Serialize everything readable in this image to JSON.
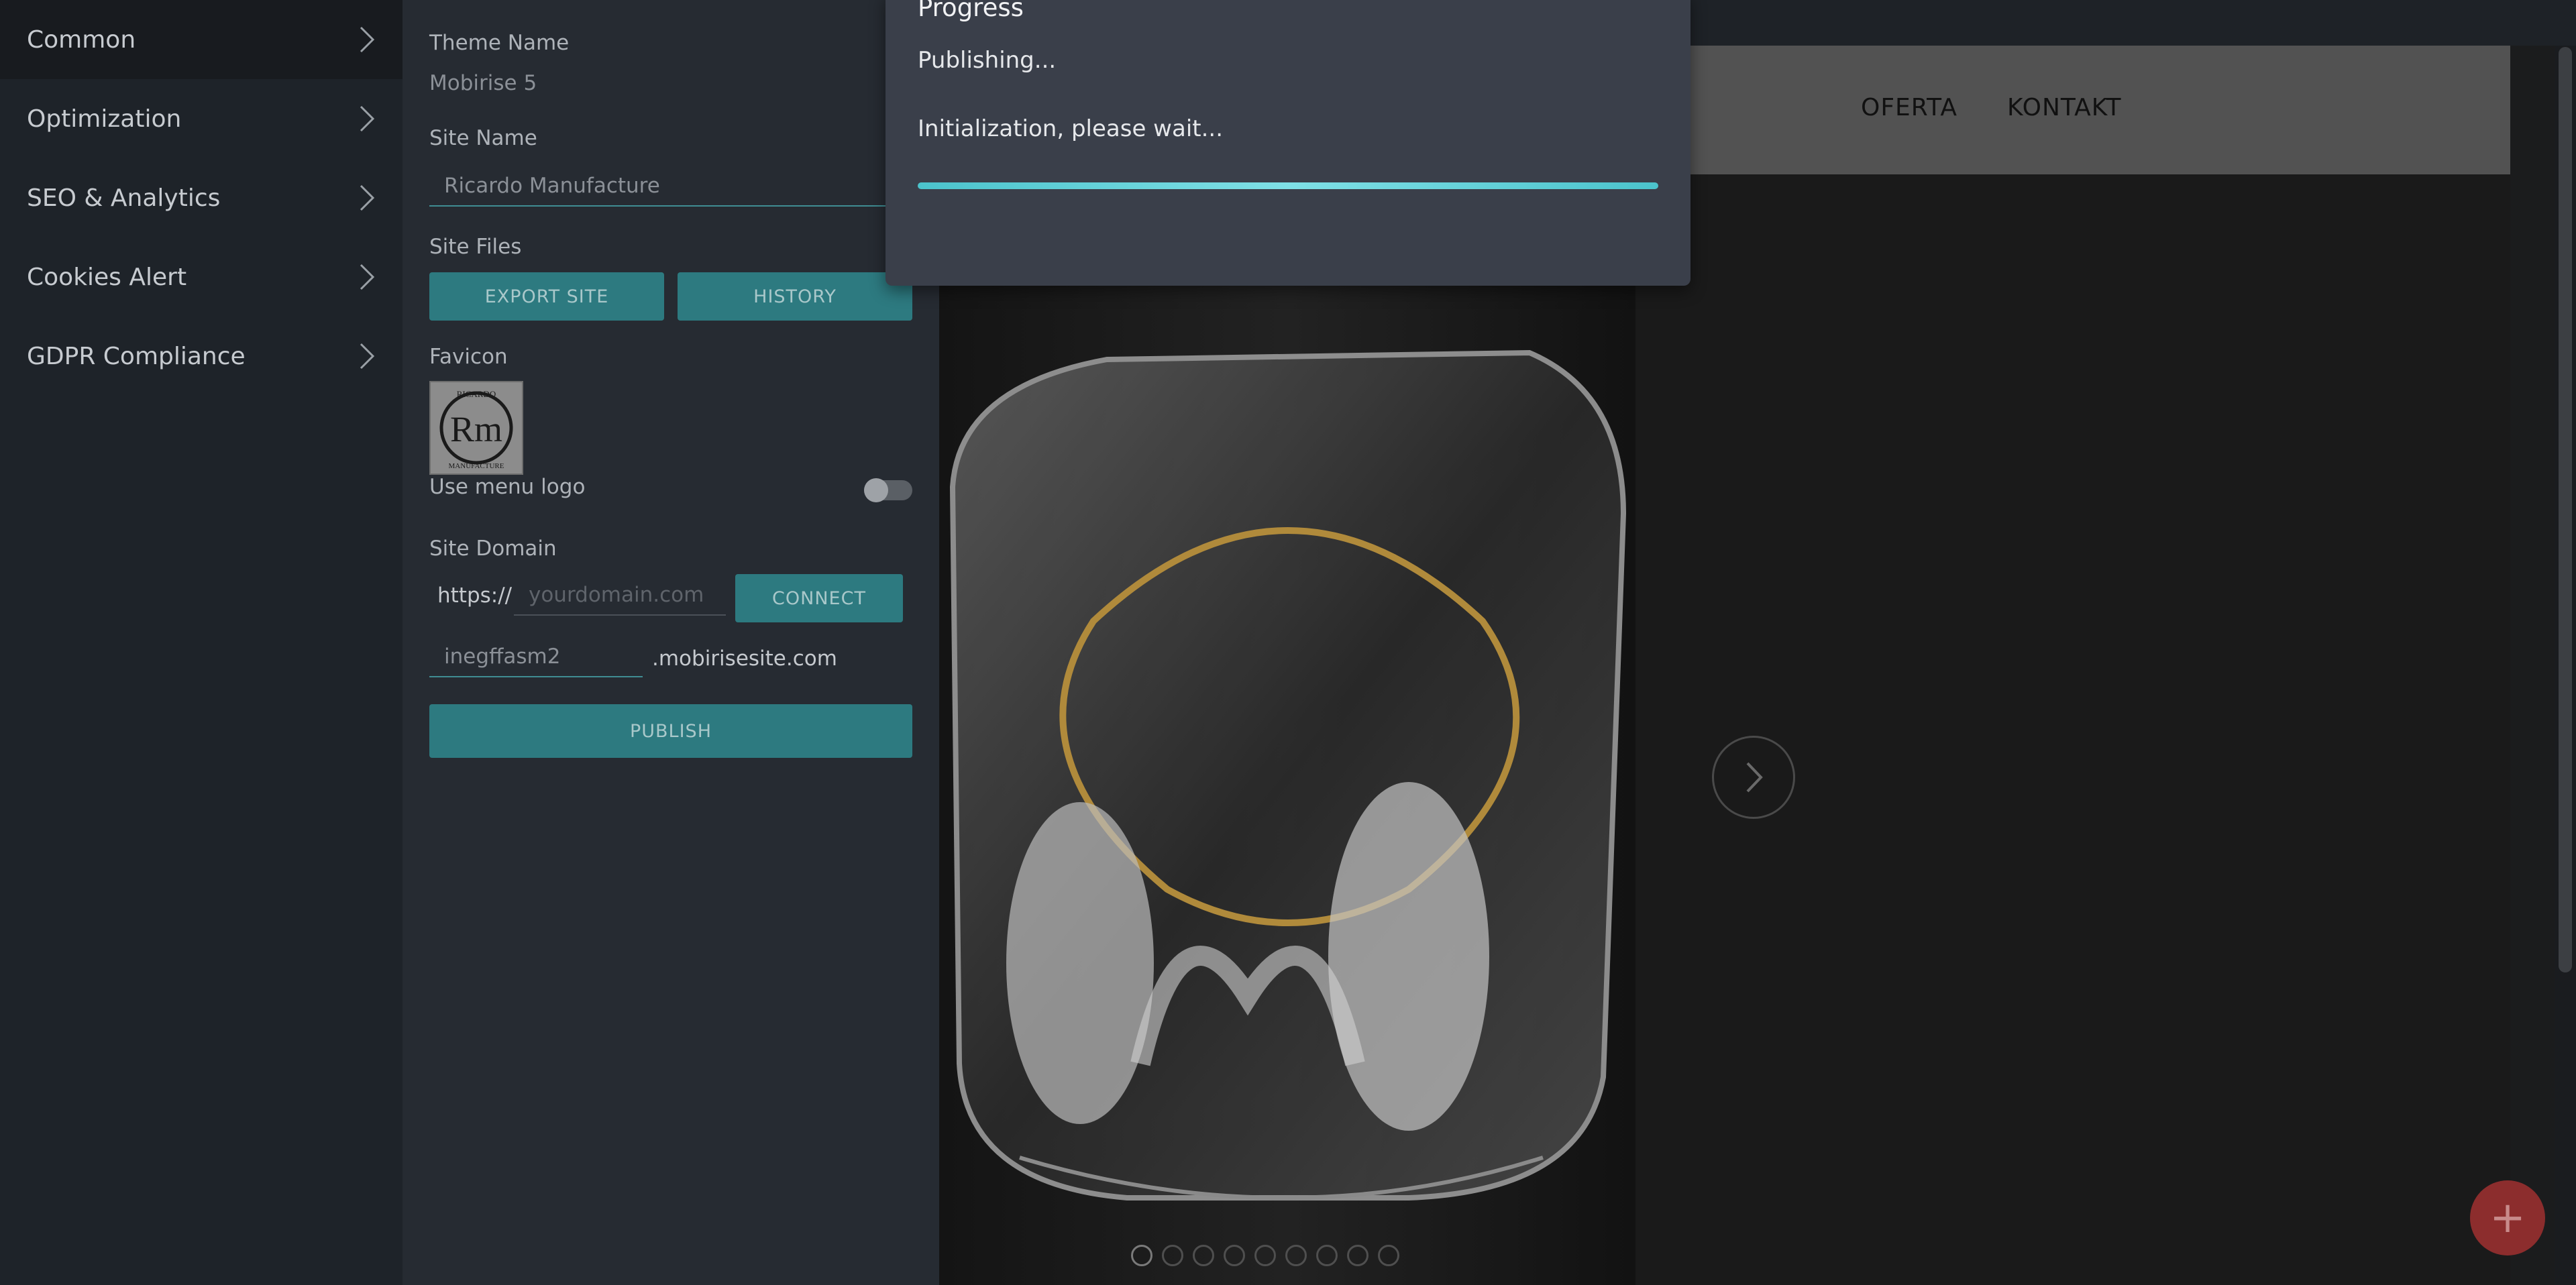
{
  "categories": [
    {
      "label": "Common",
      "active": true
    },
    {
      "label": "Optimization",
      "active": false
    },
    {
      "label": "SEO & Analytics",
      "active": false
    },
    {
      "label": "Cookies Alert",
      "active": false
    },
    {
      "label": "GDPR Compliance",
      "active": false
    }
  ],
  "settings": {
    "theme_name_label": "Theme Name",
    "theme_name_value": "Mobirise 5",
    "site_name_label": "Site Name",
    "site_name_value": "Ricardo Manufacture",
    "site_files_label": "Site Files",
    "export_button": "EXPORT SITE",
    "history_button": "HISTORY",
    "favicon_label": "Favicon",
    "favicon_logo_text_top": "RICARDO",
    "favicon_logo_text_bottom": "MANUFACTURE",
    "use_menu_logo_label": "Use menu logo",
    "use_menu_logo_on": false,
    "site_domain_label": "Site Domain",
    "domain_prefix": "https://",
    "domain_placeholder": "yourdomain.com",
    "connect_button": "CONNECT",
    "subdomain_value": "inegffasm2",
    "subdomain_suffix": ".mobirisesite.com",
    "publish_button": "PUBLISH"
  },
  "preview": {
    "nav_links": [
      "OFERTA",
      "KONTAKT"
    ],
    "slider_dot_count": 9,
    "active_dot": 1
  },
  "dialog": {
    "title": "Progress",
    "status": "Publishing...",
    "info": "Initialization, please wait...",
    "progress_fraction": 1.0
  },
  "colors": {
    "accent": "#2d7a80",
    "progress": "#4bc3cc",
    "fab": "#8c2d2d"
  }
}
